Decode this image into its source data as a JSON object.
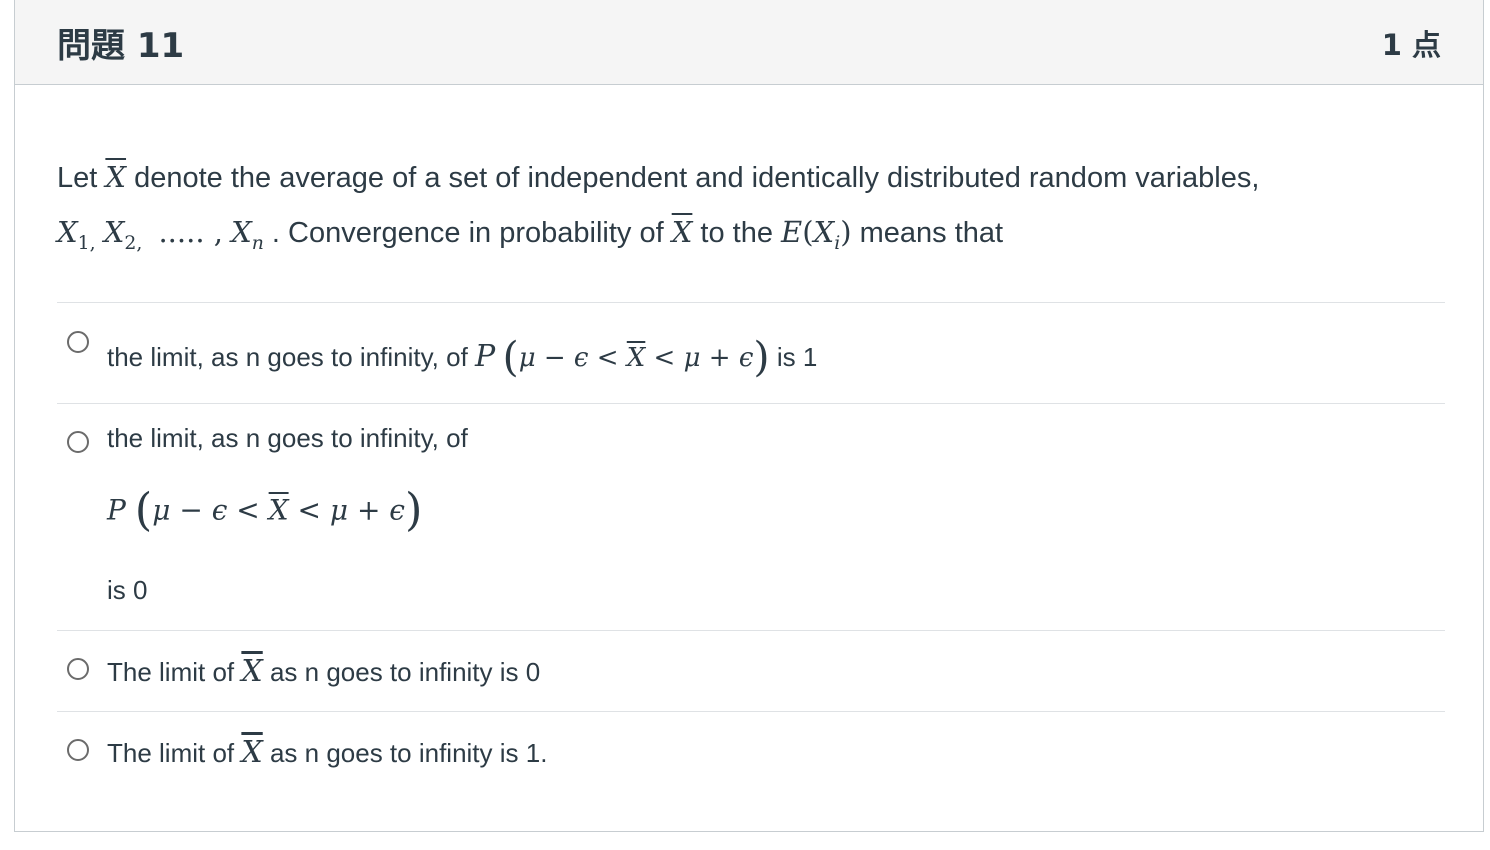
{
  "header": {
    "title": "問題 11",
    "points": "1 点"
  },
  "question": {
    "p1": "Let ",
    "xbar": "X",
    "p2": " denote the average of a set of independent and identically distributed random variables,",
    "x1": "X",
    "s1": "1,",
    "x2": "X",
    "s2": "2,",
    "dots": "..... ,",
    "xn": "X",
    "sn": "n",
    "p3": " . Convergence in probability of ",
    "p4": " to the ",
    "E": "E",
    "lp": "(",
    "xi": "X",
    "si": "i",
    "rp": ")",
    "p5": " means that"
  },
  "answers": [
    {
      "pre": "the limit, as n goes to infinity,  of ",
      "P": "P",
      "expr_a": "μ − ϵ < ",
      "xbar": "X",
      "expr_b": " < μ + ϵ",
      "post": " is 1"
    },
    {
      "pre": "the limit, as n goes to infinity,  of",
      "P": "P",
      "expr_a": "μ − ϵ < ",
      "xbar": "X",
      "expr_b": " < μ + ϵ",
      "post": "is 0"
    },
    {
      "pre": "The limit of ",
      "xbar": "X",
      "post": " as n goes to infinity is 0"
    },
    {
      "pre": "The limit of ",
      "xbar": "X",
      "post": " as n goes to infinity is 1."
    }
  ],
  "paren_open": "(",
  "paren_close": ")"
}
